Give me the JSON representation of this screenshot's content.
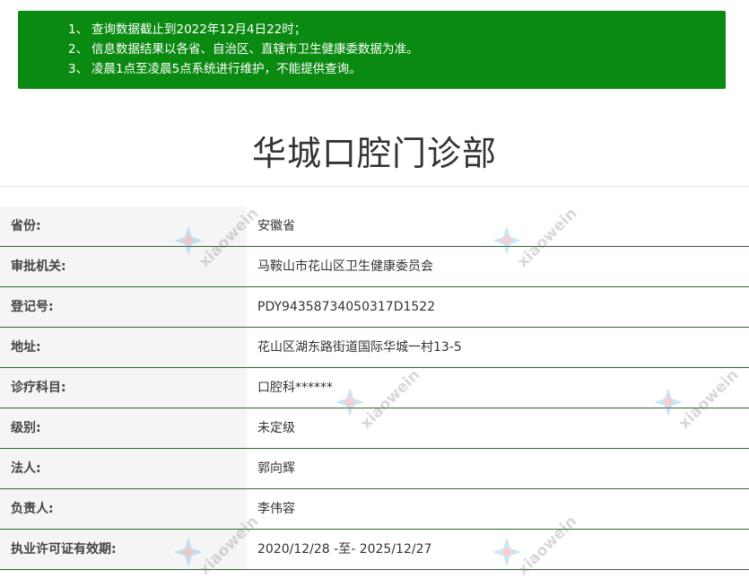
{
  "notice": {
    "lines": [
      {
        "num": "1、",
        "text": "查询数据截止到2022年12月4日22时；"
      },
      {
        "num": "2、",
        "text": "信息数据结果以各省、自治区、直辖市卫生健康委数据为准。"
      },
      {
        "num": "3、",
        "text": "凌晨1点至凌晨5点系统进行维护，不能提供查询。"
      }
    ]
  },
  "title": "华城口腔门诊部",
  "rows": [
    {
      "label": "省份:",
      "value": "安徽省"
    },
    {
      "label": "审批机关:",
      "value": "马鞍山市花山区卫生健康委员会"
    },
    {
      "label": "登记号:",
      "value": "PDY94358734050317D1522"
    },
    {
      "label": "地址:",
      "value": "花山区湖东路街道国际华城一村13-5"
    },
    {
      "label": "诊疗科目:",
      "value": "口腔科******"
    },
    {
      "label": "级别:",
      "value": "未定级"
    },
    {
      "label": "法人:",
      "value": "郭向辉"
    },
    {
      "label": "负责人:",
      "value": "李伟容"
    },
    {
      "label": "执业许可证有效期:",
      "value": "2020/12/28 -至- 2025/12/27"
    }
  ],
  "watermark": {
    "text": "xiaowein"
  },
  "colors": {
    "notice_bg": "#0b8a12",
    "row_border": "#2a6b2a",
    "label_bg": "#f5f5f5"
  }
}
